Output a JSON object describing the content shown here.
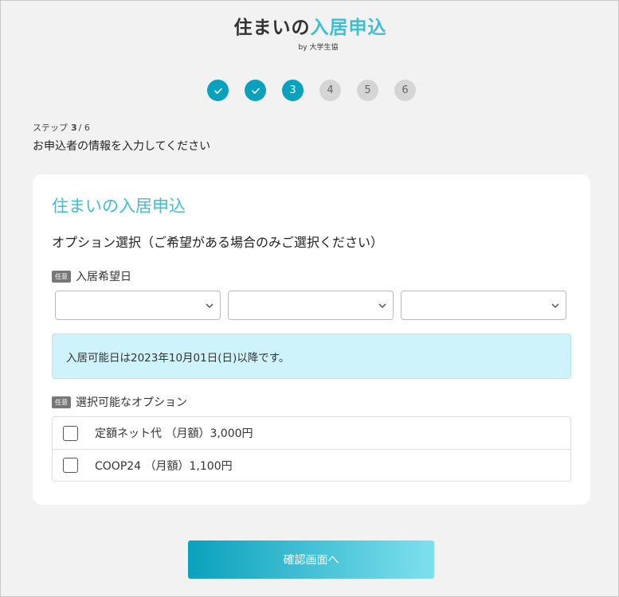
{
  "header": {
    "title_part1": "住まいの",
    "title_part2": "入居申込",
    "subtitle": "by 大学生協"
  },
  "steps": [
    {
      "label": "",
      "state": "done"
    },
    {
      "label": "",
      "state": "done"
    },
    {
      "label": "3",
      "state": "current"
    },
    {
      "label": "4",
      "state": "pending"
    },
    {
      "label": "5",
      "state": "pending"
    },
    {
      "label": "6",
      "state": "pending"
    }
  ],
  "progress": {
    "prefix": "ステップ",
    "current": "3",
    "total": "/ 6",
    "description": "お申込者の情報を入力してください"
  },
  "card": {
    "title": "住まいの入居申込",
    "section_title": "オプション選択（ご希望がある場合のみご選択ください）",
    "badge": "任意",
    "move_in_label": "入居希望日",
    "info_text": "入居可能日は2023年10月01日(日)以降です。",
    "options_label": "選択可能なオプション",
    "options": [
      {
        "label": "定額ネット代 （月額）3,000円",
        "checked": false
      },
      {
        "label": "COOP24 （月額）1,100円",
        "checked": false
      }
    ]
  },
  "footer": {
    "confirm_label": "確認画面へ"
  },
  "colors": {
    "accent": "#0aa1bc",
    "title_accent": "#3cbfd2",
    "info_bg": "#cff3fa",
    "pending_step": "#d5d5d5"
  }
}
